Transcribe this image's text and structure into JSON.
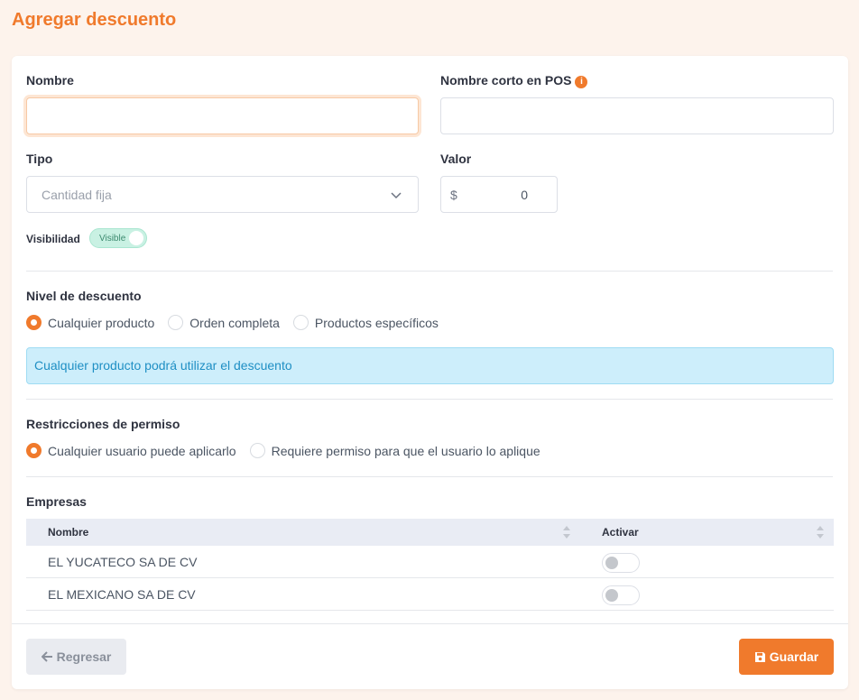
{
  "page": {
    "title": "Agregar descuento"
  },
  "form": {
    "nombre_label": "Nombre",
    "nombre_value": "",
    "nombre_corto_label": "Nombre corto en POS",
    "nombre_corto_value": "",
    "tipo_label": "Tipo",
    "tipo_selected": "Cantidad fija",
    "valor_label": "Valor",
    "valor_prefix": "$",
    "valor_value": "0",
    "visibilidad_label": "Visibilidad",
    "visibilidad_toggle": "Visible"
  },
  "nivel": {
    "title": "Nivel de descuento",
    "options": [
      "Cualquier producto",
      "Orden completa",
      "Productos específicos"
    ],
    "selected": "Cualquier producto",
    "alert": "Cualquier producto podrá utilizar el descuento"
  },
  "restricciones": {
    "title": "Restricciones de permiso",
    "options": [
      "Cualquier usuario puede aplicarlo",
      "Requiere permiso para que el usuario lo aplique"
    ],
    "selected": "Cualquier usuario puede aplicarlo"
  },
  "empresas": {
    "title": "Empresas",
    "columns": [
      "Nombre",
      "Activar"
    ],
    "rows": [
      {
        "name": "EL YUCATECO SA DE CV",
        "active": false
      },
      {
        "name": "EL MEXICANO SA DE CV",
        "active": false
      }
    ]
  },
  "footer": {
    "back_label": "Regresar",
    "save_label": "Guardar"
  },
  "colors": {
    "accent": "#f07a2c",
    "info_bg": "#cdeefb",
    "info_text": "#1f8fc4",
    "visible_toggle": "#c9f1e3"
  }
}
